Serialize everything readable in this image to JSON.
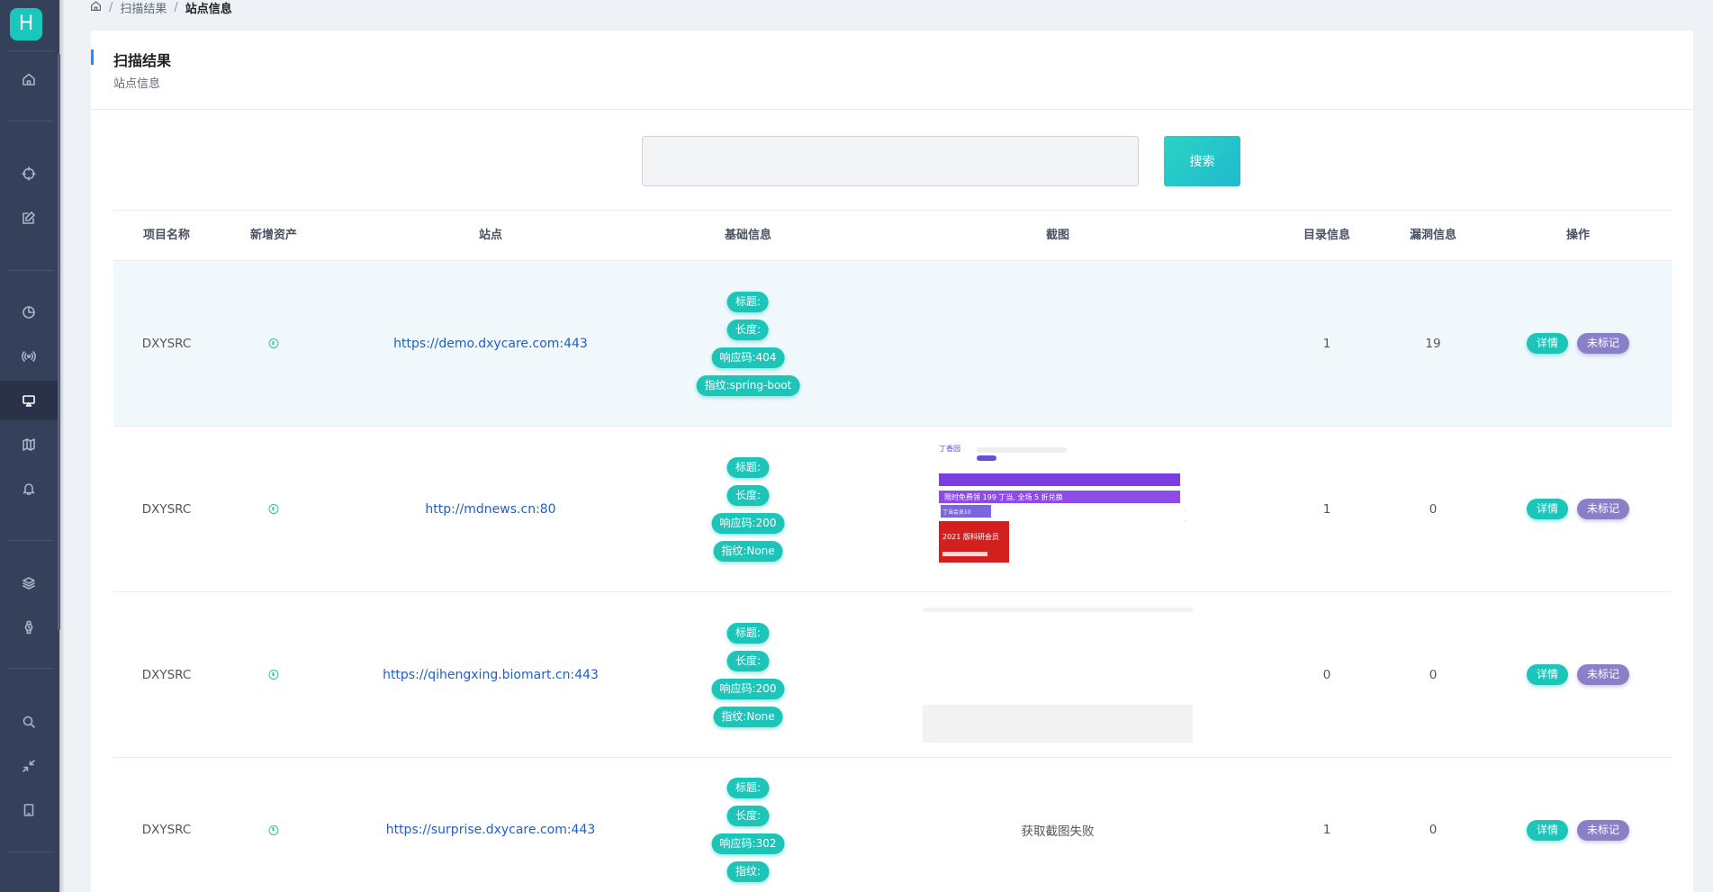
{
  "app": {
    "logo_letter": "H"
  },
  "breadcrumb": {
    "items": [
      "扫描结果",
      "站点信息"
    ],
    "separator": "/"
  },
  "page": {
    "title": "扫描结果",
    "subtitle": "站点信息"
  },
  "search": {
    "value": "",
    "placeholder": "",
    "button_label": "搜索"
  },
  "sidebar": {
    "icons": [
      "home-icon",
      "crosshair-icon",
      "edit-icon",
      "pie-chart-icon",
      "broadcast-icon",
      "monitor-icon",
      "map-icon",
      "bell-icon",
      "layers-icon",
      "watch-icon",
      "search-icon",
      "collapse-icon",
      "tablet-icon"
    ],
    "active": "monitor-icon"
  },
  "table": {
    "headers": [
      "项目名称",
      "新增资产",
      "站点",
      "基础信息",
      "截图",
      "目录信息",
      "漏洞信息",
      "操作"
    ],
    "rows": [
      {
        "project": "DXYSRC",
        "site": "https://demo.dxycare.com:443",
        "tags": [
          "标题:",
          "长度:",
          "响应码:404",
          "指纹:spring-boot"
        ],
        "screenshot": "",
        "dir_info": "1",
        "vuln_info": "19",
        "detail": "详情",
        "mark": "未标记"
      },
      {
        "project": "DXYSRC",
        "site": "http://mdnews.cn:80",
        "tags": [
          "标题:",
          "长度:",
          "响应码:200",
          "指纹:None"
        ],
        "screenshot": "",
        "shot_texts": [
          "丁当会员10",
          "限时免费领 199 丁当, 全场 5 折兑换",
          "2021 版科研会员"
        ],
        "dir_info": "1",
        "vuln_info": "0",
        "detail": "详情",
        "mark": "未标记"
      },
      {
        "project": "DXYSRC",
        "site": "https://qihengxing.biomart.cn:443",
        "tags": [
          "标题:",
          "长度:",
          "响应码:200",
          "指纹:None"
        ],
        "screenshot": "",
        "dir_info": "0",
        "vuln_info": "0",
        "detail": "详情",
        "mark": "未标记"
      },
      {
        "project": "DXYSRC",
        "site": "https://surprise.dxycare.com:443",
        "tags": [
          "标题:",
          "长度:",
          "响应码:302",
          "指纹:"
        ],
        "screenshot": "获取截图失败",
        "dir_info": "1",
        "vuln_info": "0",
        "detail": "详情",
        "mark": "未标记"
      }
    ]
  },
  "colors": {
    "sidebar_bg": "#35405a",
    "accent": "#1dc5b9",
    "mark_purple": "#8a80c7",
    "link": "#1f5fc8",
    "highlight_row": "#f1f8fc"
  }
}
